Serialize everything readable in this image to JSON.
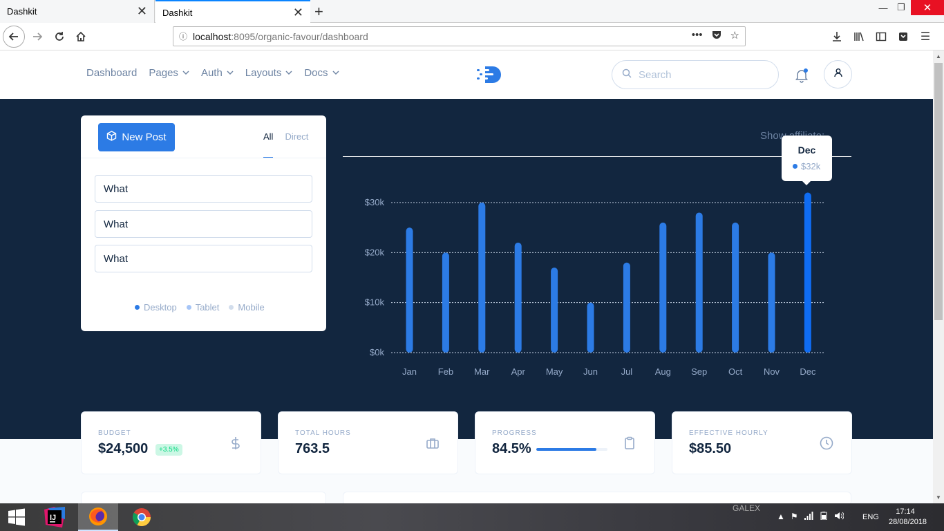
{
  "browser": {
    "tabs": [
      {
        "title": "Dashkit"
      },
      {
        "title": "Dashkit"
      }
    ],
    "url_host": "localhost",
    "url_rest": ":8095/organic-favour/dashboard"
  },
  "header": {
    "menu": [
      {
        "label": "Dashboard"
      },
      {
        "label": "Pages"
      },
      {
        "label": "Auth"
      },
      {
        "label": "Layouts"
      },
      {
        "label": "Docs"
      }
    ],
    "search_placeholder": "Search"
  },
  "post_card": {
    "new_post_label": "New Post",
    "tabs": [
      {
        "label": "All",
        "active": true
      },
      {
        "label": "Direct",
        "active": false
      }
    ],
    "inputs": [
      "What",
      "What",
      "What"
    ],
    "legend": [
      {
        "label": "Desktop",
        "color": "#2c7be5"
      },
      {
        "label": "Tablet",
        "color": "#a6c5f7"
      },
      {
        "label": "Mobile",
        "color": "#d2ddec"
      }
    ]
  },
  "affiliate_toggle": "Show affiliate:",
  "chart_data": {
    "type": "bar",
    "categories": [
      "Jan",
      "Feb",
      "Mar",
      "Apr",
      "May",
      "Jun",
      "Jul",
      "Aug",
      "Sep",
      "Oct",
      "Nov",
      "Dec"
    ],
    "values": [
      25,
      20,
      30,
      22,
      17,
      10,
      18,
      26,
      28,
      26,
      20,
      32
    ],
    "unit": "k",
    "yticks": [
      "$0k",
      "$10k",
      "$20k",
      "$30k"
    ],
    "ylim": [
      0,
      30
    ],
    "grid": true,
    "bar_color": "#2c7be5",
    "highlight_color": "#0f6cf2",
    "highlight": "Dec",
    "tooltip": {
      "title": "Dec",
      "value": "$32k"
    }
  },
  "stats": [
    {
      "label": "BUDGET",
      "value": "$24,500",
      "badge": "+3.5%",
      "icon": "dollar-icon"
    },
    {
      "label": "TOTAL HOURS",
      "value": "763.5",
      "icon": "briefcase-icon"
    },
    {
      "label": "PROGRESS",
      "value": "84.5%",
      "progress": 0.845,
      "icon": "clipboard-icon"
    },
    {
      "label": "EFFECTIVE HOURLY",
      "value": "$85.50",
      "icon": "clock-icon"
    }
  ],
  "taskbar": {
    "watermark": "GALEX",
    "language": "ENG",
    "time": "17:14",
    "date": "28/08/2018"
  }
}
